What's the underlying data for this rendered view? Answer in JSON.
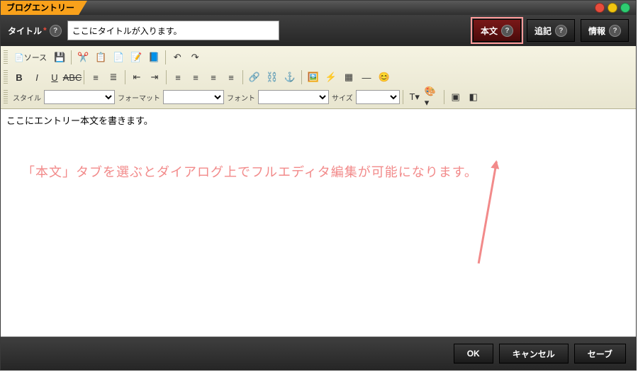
{
  "window": {
    "title": "ブログエントリー"
  },
  "header": {
    "title_label": "タイトル",
    "title_value": "ここにタイトルが入ります。",
    "tabs": {
      "body": "本文",
      "append": "追記",
      "info": "情報"
    }
  },
  "toolbar": {
    "source_label": "ソース",
    "style_label": "スタイル",
    "format_label": "フォーマット",
    "font_label": "フォント",
    "size_label": "サイズ"
  },
  "content": {
    "body_text": "ここにエントリー本文を書きます。",
    "annotation": "「本文」タブを選ぶとダイアログ上でフルエディタ編集が可能になります。"
  },
  "footer": {
    "ok": "OK",
    "cancel": "キャンセル",
    "save": "セーブ"
  }
}
